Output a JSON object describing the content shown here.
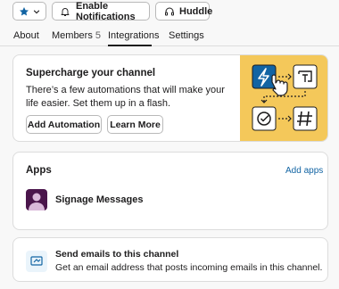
{
  "toolbar": {
    "notifications_label": "Enable Notifications",
    "huddle_label": "Huddle"
  },
  "tabs": [
    {
      "label": "About"
    },
    {
      "label": "Members",
      "count": "5"
    },
    {
      "label": "Integrations",
      "active": true
    },
    {
      "label": "Settings"
    }
  ],
  "promo": {
    "title": "Supercharge your channel",
    "description": "There’s a few automations that will make your life easier. Set them up in a flash.",
    "add_automation": "Add Automation",
    "learn_more": "Learn More"
  },
  "apps": {
    "title": "Apps",
    "add_label": "Add apps",
    "items": [
      {
        "name": "Signage Messages"
      }
    ]
  },
  "emails": {
    "title": "Send emails to this channel",
    "description": "Get an email address that posts incoming emails in this channel."
  },
  "colors": {
    "accent_blue": "#1264a3",
    "promo_bg": "#f4c85a",
    "app_avatar": "#4a154b"
  }
}
